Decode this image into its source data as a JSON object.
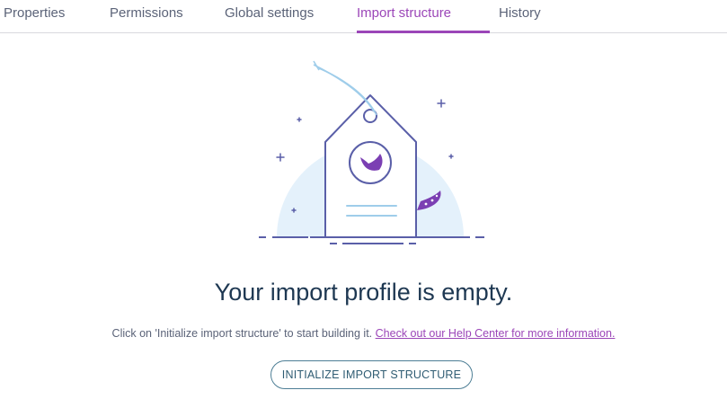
{
  "tabs": [
    {
      "label": "Properties",
      "active": false
    },
    {
      "label": "Permissions",
      "active": false
    },
    {
      "label": "Global settings",
      "active": false
    },
    {
      "label": "Import structure",
      "active": true
    },
    {
      "label": "History",
      "active": false
    }
  ],
  "empty_state": {
    "illustration_icon": "price-tag-with-logo-icon",
    "headline": "Your import profile is empty.",
    "description": "Click on 'Initialize import structure' to start building it.",
    "help_link": "Check out our Help Center for more information.",
    "button_label": "INITIALIZE IMPORT STRUCTURE"
  },
  "colors": {
    "accent": "#9b46b8",
    "heading": "#1e3852",
    "text": "#5b6378",
    "button_border": "#4d7e95",
    "illustration_line": "#5a5fa8",
    "illustration_bg": "#e4f1fb"
  }
}
